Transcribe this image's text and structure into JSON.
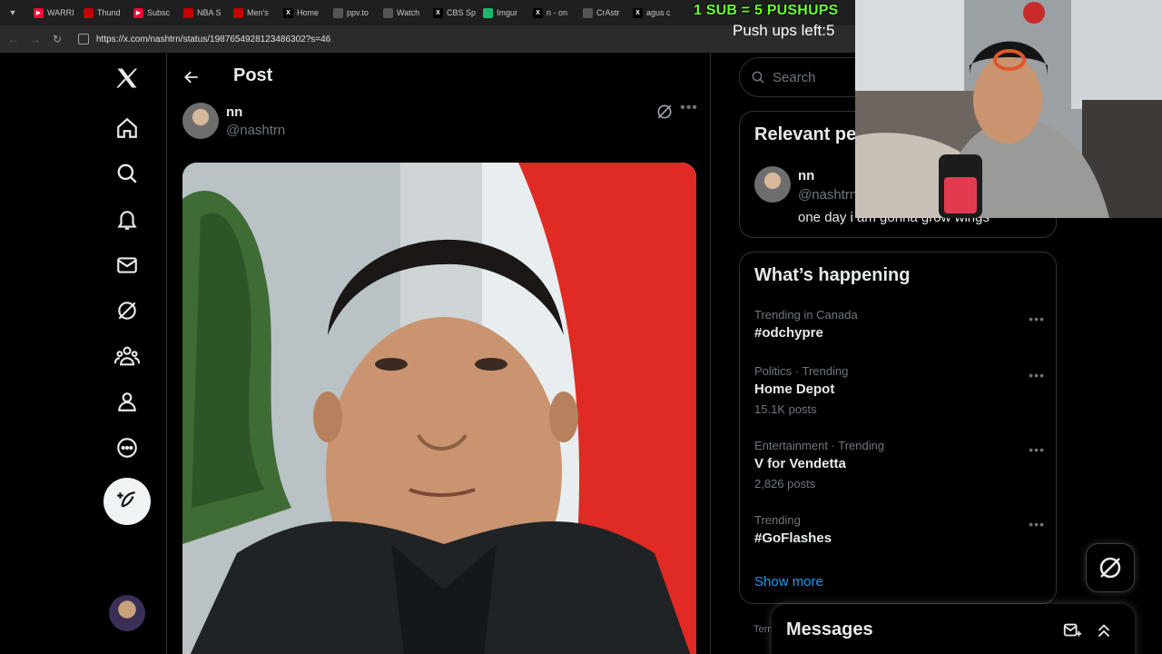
{
  "browser": {
    "tabs": [
      {
        "label": "WARRI",
        "icon": "youtube-icon"
      },
      {
        "label": "Thund",
        "icon": "red-icon"
      },
      {
        "label": "Subsc",
        "icon": "youtube-icon"
      },
      {
        "label": "NBA S",
        "icon": "red-icon"
      },
      {
        "label": "Men's",
        "icon": "red-icon"
      },
      {
        "label": "Home",
        "icon": "x-icon"
      },
      {
        "label": "ppv.to",
        "icon": "gray-icon"
      },
      {
        "label": "Watch",
        "icon": "gray-icon"
      },
      {
        "label": "CBS Sp",
        "icon": "x-icon"
      },
      {
        "label": "Imgur",
        "icon": "green-icon"
      },
      {
        "label": "n - on",
        "icon": "x-icon"
      },
      {
        "label": "CrAstr",
        "icon": "gray-icon"
      },
      {
        "label": "agus c",
        "icon": "x-icon"
      }
    ],
    "url": "https://x.com/nashtrn/status/1987654928123486302?s=46"
  },
  "overlay": {
    "sub_text": "1 SUB = 5 PUSHUPS",
    "pushups_text": "Push ups left:5"
  },
  "main": {
    "title": "Post",
    "author_name": "nn",
    "author_handle": "@nashtrn"
  },
  "search": {
    "placeholder": "Search"
  },
  "relevant": {
    "title": "Relevant pe",
    "name": "nn",
    "handle": "@nashtrn",
    "bio": "one day i am gonna grow wings"
  },
  "happening": {
    "title": "What’s happening",
    "trends": [
      {
        "meta": "Trending in Canada",
        "name": "#odchypre",
        "posts": ""
      },
      {
        "meta": "Politics · Trending",
        "name": "Home Depot",
        "posts": "15.1K posts"
      },
      {
        "meta": "Entertainment · Trending",
        "name": "V for Vendetta",
        "posts": "2,826 posts"
      },
      {
        "meta": "Trending",
        "name": "#GoFlashes",
        "posts": ""
      }
    ],
    "show_more": "Show more"
  },
  "footer": {
    "terms": "Terr"
  },
  "messages": {
    "title": "Messages"
  }
}
